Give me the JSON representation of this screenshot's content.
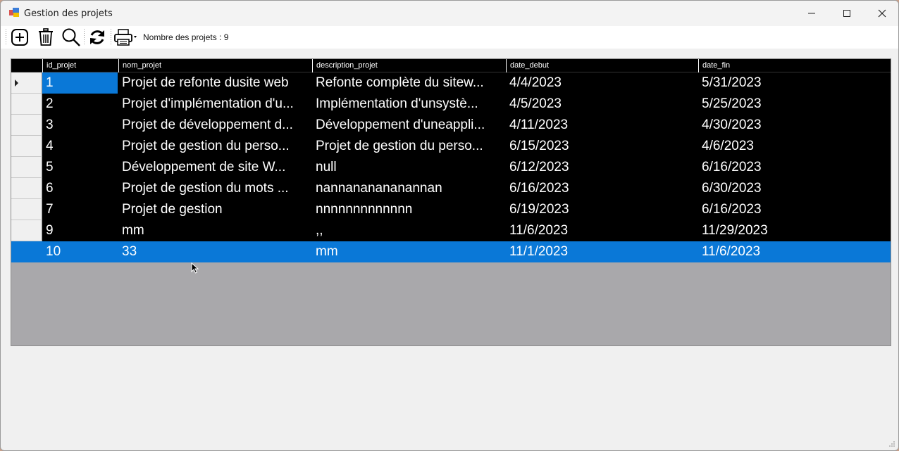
{
  "window": {
    "title": "Gestion des projets",
    "controls": {
      "minimize": "minimize-icon",
      "maximize": "maximize-icon",
      "close": "close-icon"
    }
  },
  "toolbar": {
    "tools": [
      {
        "name": "add-button",
        "icon": "plus-circle-icon"
      },
      {
        "name": "delete-button",
        "icon": "trash-icon"
      },
      {
        "name": "search-button",
        "icon": "search-icon"
      },
      {
        "name": "refresh-button",
        "icon": "refresh-icon"
      },
      {
        "name": "print-button",
        "icon": "printer-icon"
      }
    ],
    "count_label": "Nombre des projets : 9"
  },
  "grid": {
    "columns": [
      "id_projet",
      "nom_projet",
      "description_projet",
      "date_debut",
      "date_fin"
    ],
    "rows": [
      [
        "1",
        "Projet de refonte dusite web",
        "Refonte complète du sitew...",
        "4/4/2023",
        "5/31/2023"
      ],
      [
        "2",
        "Projet d'implémentation d'u...",
        "Implémentation d'unsystè...",
        "4/5/2023",
        "5/25/2023"
      ],
      [
        "3",
        "Projet de développement d...",
        "Développement d'uneappli...",
        "4/11/2023",
        "4/30/2023"
      ],
      [
        "4",
        "Projet de gestion du perso...",
        "Projet de gestion du perso...",
        "6/15/2023",
        "4/6/2023"
      ],
      [
        "5",
        "Développement de site W...",
        "null",
        "6/12/2023",
        "6/16/2023"
      ],
      [
        "6",
        "Projet de gestion du mots ...",
        "nannananananannan",
        "6/16/2023",
        "6/30/2023"
      ],
      [
        "7",
        "Projet de gestion",
        "nnnnnnnnnnnnn",
        "6/19/2023",
        "6/16/2023"
      ],
      [
        "9",
        "mm",
        ",,",
        "11/6/2023",
        "11/29/2023"
      ],
      [
        "10",
        "33",
        "mm",
        "11/1/2023",
        "11/6/2023"
      ]
    ],
    "current_row": 0,
    "selected_row": 8,
    "colors": {
      "selection": "#0a78d7",
      "row_background": "#000000",
      "empty_area": "#a9a8ab"
    }
  }
}
